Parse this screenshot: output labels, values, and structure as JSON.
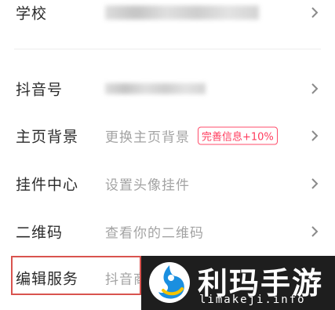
{
  "rows": [
    {
      "label": "学校",
      "value": "",
      "badge": ""
    },
    {
      "label": "抖音号",
      "value": "",
      "badge": ""
    },
    {
      "label": "主页背景",
      "value": "更换主页背景",
      "badge": "完善信息+10%"
    },
    {
      "label": "挂件中心",
      "value": "设置头像挂件",
      "badge": ""
    },
    {
      "label": "二维码",
      "value": "查看你的二维码",
      "badge": ""
    },
    {
      "label": "编辑服务",
      "value": "抖音商",
      "badge": ""
    }
  ],
  "watermark": {
    "title": "利玛手游",
    "url": "limakeji.info"
  },
  "colors": {
    "label": "#2b2b2b",
    "value": "#a3a3a3",
    "badge": "#ff3b5c",
    "highlight": "#d9534f",
    "watermark_bg": "#1e1e1e"
  },
  "icons": {
    "chevron": "chevron-right-icon",
    "watermark_logo": "limakeji-logo"
  }
}
